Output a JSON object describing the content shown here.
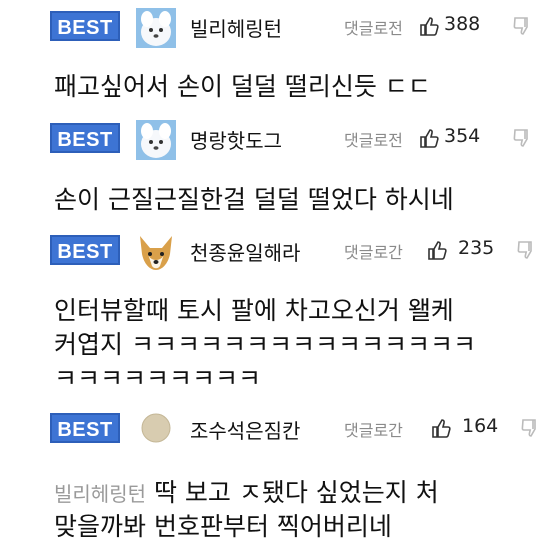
{
  "comments": [
    {
      "badge": "BEST",
      "nickname": "빌리헤링턴",
      "meta": "댓글로",
      "meta_overlap": "전",
      "likes": "388",
      "text_lines": [
        "패고싶어서 손이 덜덜 떨리신듯 ㄷㄷ"
      ]
    },
    {
      "badge": "BEST",
      "nickname": "명랑핫도그",
      "meta": "댓글로",
      "meta_overlap": "전",
      "likes": "354",
      "text_lines": [
        "손이 근질근질한걸 덜덜 떨었다 하시네"
      ]
    },
    {
      "badge": "BEST",
      "nickname": "천종윤일해라",
      "meta": "댓글로",
      "meta_overlap": "간",
      "likes": "235",
      "text_lines": [
        "인터뷰할때 토시 팔에 차고오신거 왤케",
        "커엽지 ㅋㅋㅋㅋㅋㅋㅋㅋㅋㅋㅋㅋㅋㅋㅋ",
        "ㅋㅋㅋㅋㅋㅋㅋㅋㅋ"
      ]
    },
    {
      "badge": "BEST",
      "nickname": "조수석은짐칸",
      "meta": "댓글로",
      "meta_overlap": "간",
      "likes": "164",
      "reply_to": "빌리헤링턴",
      "text_lines": [
        "딱 보고 ㅈ됐다 싶었는지 처",
        "맞을까봐 번호판부터 찍어버리네"
      ]
    }
  ],
  "icons": {
    "like": "thumbs-up-icon",
    "dislike": "thumbs-down-icon"
  },
  "colors": {
    "badge_bg": "#3d74d4",
    "meta_text": "#8a8a8a"
  }
}
